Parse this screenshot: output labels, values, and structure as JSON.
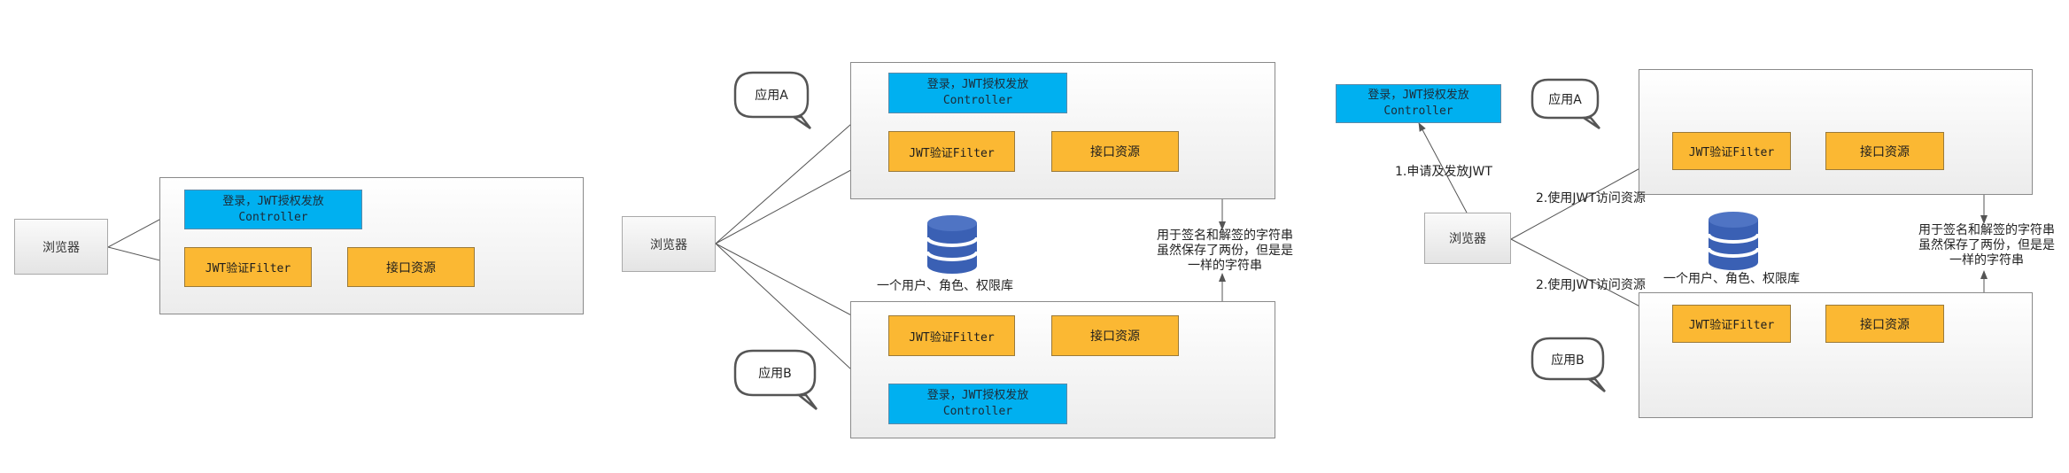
{
  "nodes": {
    "browser": "浏览器",
    "login_line1": "登录，JWT授权发放",
    "login_line2": "Controller",
    "jwt_filter": "JWT验证Filter",
    "api_resource": "接口资源",
    "app_a": "应用A",
    "app_b": "应用B",
    "db_caption": "一个用户、角色、权限库"
  },
  "key_note": {
    "line1": "用于签名和解签的字符串",
    "line2": "虽然保存了两份，但是是",
    "line3": "一样的字符串"
  },
  "edges": {
    "request_jwt": "1.申请及发放JWT",
    "use_jwt": "2.使用JWT访问资源"
  },
  "colors": {
    "controller_fill": "#00b0f0",
    "filter_fill": "#fbb833",
    "database_fill": "#3a60b4"
  },
  "icons": [
    "key-icon",
    "database-icon",
    "speech-bubble-icon",
    "arrow-head-icon"
  ]
}
